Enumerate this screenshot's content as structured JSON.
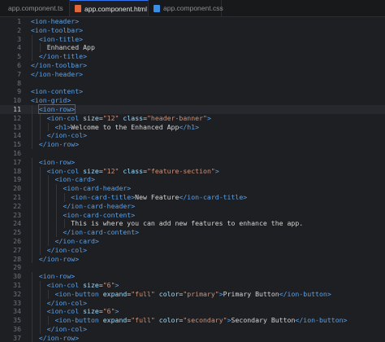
{
  "tabs": [
    {
      "label": "app.component.ts",
      "icon": "typescript-file-icon",
      "active": false
    },
    {
      "label": "app.component.html",
      "icon": "html-file-icon",
      "active": true
    },
    {
      "label": "app.component.css",
      "icon": "css-file-icon",
      "active": false
    }
  ],
  "close_glyph": "×",
  "colors": {
    "tag": "#5aa0e6",
    "attr": "#9cdcfe",
    "string": "#ce9178",
    "text": "#d4d4d4",
    "background": "#1e1f22"
  },
  "active_line": 11,
  "lines": [
    {
      "n": "1",
      "indent": 0,
      "tokens": [
        [
          "tag",
          "<ion-header>"
        ]
      ]
    },
    {
      "n": "2",
      "indent": 0,
      "tokens": [
        [
          "tag",
          "<ion-toolbar>"
        ]
      ]
    },
    {
      "n": "3",
      "indent": 1,
      "tokens": [
        [
          "tag",
          "<ion-title>"
        ]
      ]
    },
    {
      "n": "4",
      "indent": 2,
      "tokens": [
        [
          "txt",
          "Enhanced App"
        ]
      ]
    },
    {
      "n": "5",
      "indent": 1,
      "tokens": [
        [
          "tag",
          "</ion-title>"
        ]
      ]
    },
    {
      "n": "6",
      "indent": 0,
      "tokens": [
        [
          "tag",
          "</ion-toolbar>"
        ]
      ]
    },
    {
      "n": "7",
      "indent": 0,
      "tokens": [
        [
          "tag",
          "</ion-header>"
        ]
      ]
    },
    {
      "n": "8",
      "indent": 0,
      "tokens": []
    },
    {
      "n": "9",
      "indent": 0,
      "tokens": [
        [
          "tag",
          "<ion-content>"
        ]
      ]
    },
    {
      "n": "10",
      "indent": 0,
      "tokens": [
        [
          "tag",
          "<ion-grid>"
        ]
      ]
    },
    {
      "n": "11",
      "indent": 1,
      "tokens": [
        [
          "tag",
          "<ion-row>"
        ]
      ]
    },
    {
      "n": "12",
      "indent": 2,
      "tokens": [
        [
          "tag",
          "<ion-col "
        ],
        [
          "attr",
          "size"
        ],
        [
          "eq",
          "="
        ],
        [
          "str",
          "\"12\""
        ],
        [
          "txt",
          " "
        ],
        [
          "attr",
          "class"
        ],
        [
          "eq",
          "="
        ],
        [
          "str",
          "\"header-banner\""
        ],
        [
          "tag",
          ">"
        ]
      ]
    },
    {
      "n": "13",
      "indent": 3,
      "tokens": [
        [
          "tag",
          "<h1>"
        ],
        [
          "txt",
          "Welcome to the Enhanced App"
        ],
        [
          "tag",
          "</h1>"
        ]
      ]
    },
    {
      "n": "14",
      "indent": 2,
      "tokens": [
        [
          "tag",
          "</ion-col>"
        ]
      ]
    },
    {
      "n": "15",
      "indent": 1,
      "tokens": [
        [
          "tag",
          "</ion-row>"
        ]
      ]
    },
    {
      "n": "16",
      "indent": 0,
      "tokens": []
    },
    {
      "n": "17",
      "indent": 1,
      "tokens": [
        [
          "tag",
          "<ion-row>"
        ]
      ]
    },
    {
      "n": "18",
      "indent": 2,
      "tokens": [
        [
          "tag",
          "<ion-col "
        ],
        [
          "attr",
          "size"
        ],
        [
          "eq",
          "="
        ],
        [
          "str",
          "\"12\""
        ],
        [
          "txt",
          " "
        ],
        [
          "attr",
          "class"
        ],
        [
          "eq",
          "="
        ],
        [
          "str",
          "\"feature-section\""
        ],
        [
          "tag",
          ">"
        ]
      ]
    },
    {
      "n": "19",
      "indent": 3,
      "tokens": [
        [
          "tag",
          "<ion-card>"
        ]
      ]
    },
    {
      "n": "20",
      "indent": 4,
      "tokens": [
        [
          "tag",
          "<ion-card-header>"
        ]
      ]
    },
    {
      "n": "21",
      "indent": 5,
      "tokens": [
        [
          "tag",
          "<ion-card-title>"
        ],
        [
          "txt",
          "New Feature"
        ],
        [
          "tag",
          "</ion-card-title>"
        ]
      ]
    },
    {
      "n": "22",
      "indent": 4,
      "tokens": [
        [
          "tag",
          "</ion-card-header>"
        ]
      ]
    },
    {
      "n": "23",
      "indent": 4,
      "tokens": [
        [
          "tag",
          "<ion-card-content>"
        ]
      ]
    },
    {
      "n": "24",
      "indent": 5,
      "tokens": [
        [
          "txt",
          "This is where you can add new features to enhance the app."
        ]
      ]
    },
    {
      "n": "25",
      "indent": 4,
      "tokens": [
        [
          "tag",
          "</ion-card-content>"
        ]
      ]
    },
    {
      "n": "26",
      "indent": 3,
      "tokens": [
        [
          "tag",
          "</ion-card>"
        ]
      ]
    },
    {
      "n": "27",
      "indent": 2,
      "tokens": [
        [
          "tag",
          "</ion-col>"
        ]
      ]
    },
    {
      "n": "28",
      "indent": 1,
      "tokens": [
        [
          "tag",
          "</ion-row>"
        ]
      ]
    },
    {
      "n": "29",
      "indent": 0,
      "tokens": []
    },
    {
      "n": "30",
      "indent": 1,
      "tokens": [
        [
          "tag",
          "<ion-row>"
        ]
      ]
    },
    {
      "n": "31",
      "indent": 2,
      "tokens": [
        [
          "tag",
          "<ion-col "
        ],
        [
          "attr",
          "size"
        ],
        [
          "eq",
          "="
        ],
        [
          "str",
          "\"6\""
        ],
        [
          "tag",
          ">"
        ]
      ]
    },
    {
      "n": "32",
      "indent": 3,
      "tokens": [
        [
          "tag",
          "<ion-button "
        ],
        [
          "attr",
          "expand"
        ],
        [
          "eq",
          "="
        ],
        [
          "str",
          "\"full\""
        ],
        [
          "txt",
          " "
        ],
        [
          "attr",
          "color"
        ],
        [
          "eq",
          "="
        ],
        [
          "str",
          "\"primary\""
        ],
        [
          "tag",
          ">"
        ],
        [
          "txt",
          "Primary Button"
        ],
        [
          "tag",
          "</ion-button>"
        ]
      ]
    },
    {
      "n": "33",
      "indent": 2,
      "tokens": [
        [
          "tag",
          "</ion-col>"
        ]
      ]
    },
    {
      "n": "34",
      "indent": 2,
      "tokens": [
        [
          "tag",
          "<ion-col "
        ],
        [
          "attr",
          "size"
        ],
        [
          "eq",
          "="
        ],
        [
          "str",
          "\"6\""
        ],
        [
          "tag",
          ">"
        ]
      ]
    },
    {
      "n": "35",
      "indent": 3,
      "tokens": [
        [
          "tag",
          "<ion-button "
        ],
        [
          "attr",
          "expand"
        ],
        [
          "eq",
          "="
        ],
        [
          "str",
          "\"full\""
        ],
        [
          "txt",
          " "
        ],
        [
          "attr",
          "color"
        ],
        [
          "eq",
          "="
        ],
        [
          "str",
          "\"secondary\""
        ],
        [
          "tag",
          ">"
        ],
        [
          "txt",
          "Secondary Button"
        ],
        [
          "tag",
          "</ion-button>"
        ]
      ]
    },
    {
      "n": "36",
      "indent": 2,
      "tokens": [
        [
          "tag",
          "</ion-col>"
        ]
      ]
    },
    {
      "n": "37",
      "indent": 1,
      "tokens": [
        [
          "tag",
          "</ion-row>"
        ]
      ]
    }
  ]
}
